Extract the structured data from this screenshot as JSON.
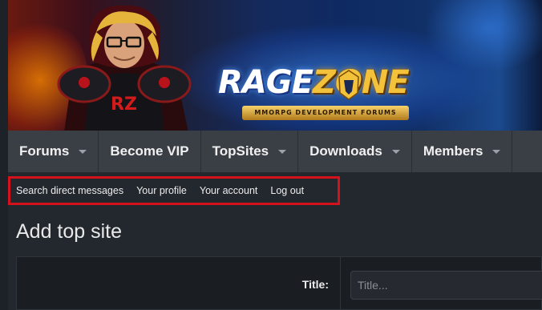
{
  "banner": {
    "logo_part1": "RAGE",
    "logo_part2": "ZONE",
    "logo_subtitle": "MMORPG DEVELOPMENT FORUMS",
    "hero_chest_letters": "RZ"
  },
  "nav": {
    "tabs": [
      {
        "label": "Forums",
        "has_dropdown": true
      },
      {
        "label": "Become VIP",
        "has_dropdown": false
      },
      {
        "label": "TopSites",
        "has_dropdown": true
      },
      {
        "label": "Downloads",
        "has_dropdown": true
      },
      {
        "label": "Members",
        "has_dropdown": true
      }
    ]
  },
  "account_nav": {
    "highlight_color": "#d5121b",
    "links": [
      {
        "label": "Search direct messages"
      },
      {
        "label": "Your profile"
      },
      {
        "label": "Your account"
      },
      {
        "label": "Log out"
      }
    ]
  },
  "page": {
    "title": "Add top site"
  },
  "form": {
    "title_label": "Title:",
    "title_placeholder": "Title...",
    "title_value": ""
  }
}
